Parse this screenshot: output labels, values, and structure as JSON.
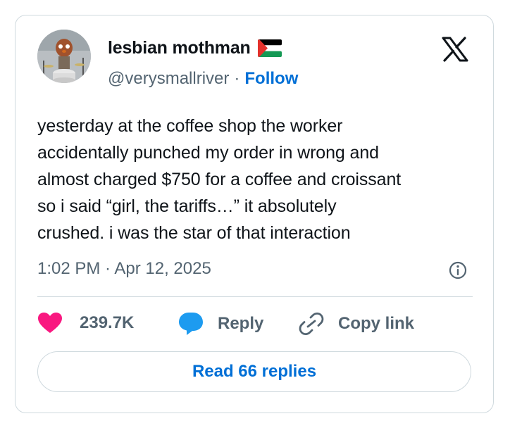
{
  "author": {
    "display_name": "lesbian mothman",
    "handle": "@verysmallriver",
    "follow_label": "Follow",
    "flag_icon": "palestine-flag-icon"
  },
  "tweet": {
    "text": "yesterday at the coffee shop the worker\naccidentally punched my order in wrong and\nalmost charged $750 for a coffee and croissant\nso i said “girl, the tariffs…” it absolutely\ncrushed. i was the star of that interaction",
    "timestamp": "1:02 PM · Apr 12, 2025"
  },
  "actions": {
    "likes": "239.7K",
    "reply_label": "Reply",
    "copy_link_label": "Copy link"
  },
  "read_replies_label": "Read 66 replies",
  "colors": {
    "accent": "#006fd6",
    "like": "#f91880",
    "reply_bubble": "#1d9bf0",
    "secondary_text": "#536471",
    "border": "#cfd9de"
  }
}
